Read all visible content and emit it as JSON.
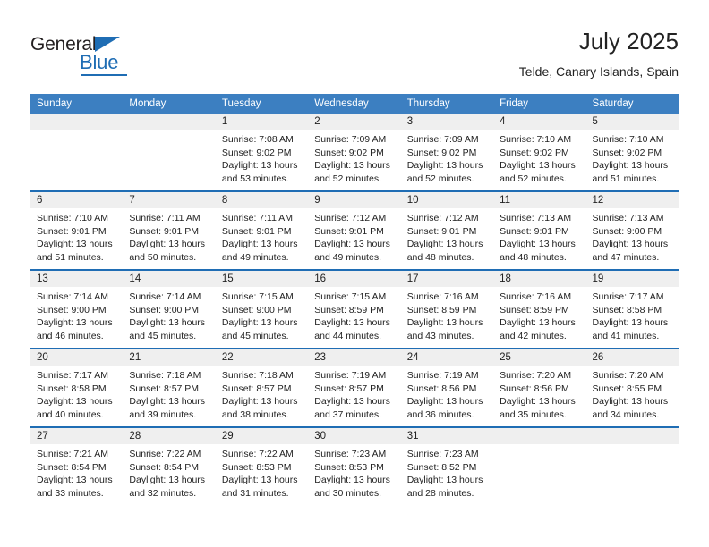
{
  "brand": {
    "name_top": "General",
    "name_bottom": "Blue"
  },
  "header": {
    "title": "July 2025",
    "location": "Telde, Canary Islands, Spain"
  },
  "colors": {
    "header_blue": "#3c7fc1",
    "accent_blue": "#1f6db4",
    "day_band_gray": "#efefef"
  },
  "weekdays": [
    "Sunday",
    "Monday",
    "Tuesday",
    "Wednesday",
    "Thursday",
    "Friday",
    "Saturday"
  ],
  "weeks": [
    [
      {
        "day": "",
        "sunrise": "",
        "sunset": "",
        "daylight": ""
      },
      {
        "day": "",
        "sunrise": "",
        "sunset": "",
        "daylight": ""
      },
      {
        "day": "1",
        "sunrise": "Sunrise: 7:08 AM",
        "sunset": "Sunset: 9:02 PM",
        "daylight": "Daylight: 13 hours and 53 minutes."
      },
      {
        "day": "2",
        "sunrise": "Sunrise: 7:09 AM",
        "sunset": "Sunset: 9:02 PM",
        "daylight": "Daylight: 13 hours and 52 minutes."
      },
      {
        "day": "3",
        "sunrise": "Sunrise: 7:09 AM",
        "sunset": "Sunset: 9:02 PM",
        "daylight": "Daylight: 13 hours and 52 minutes."
      },
      {
        "day": "4",
        "sunrise": "Sunrise: 7:10 AM",
        "sunset": "Sunset: 9:02 PM",
        "daylight": "Daylight: 13 hours and 52 minutes."
      },
      {
        "day": "5",
        "sunrise": "Sunrise: 7:10 AM",
        "sunset": "Sunset: 9:02 PM",
        "daylight": "Daylight: 13 hours and 51 minutes."
      }
    ],
    [
      {
        "day": "6",
        "sunrise": "Sunrise: 7:10 AM",
        "sunset": "Sunset: 9:01 PM",
        "daylight": "Daylight: 13 hours and 51 minutes."
      },
      {
        "day": "7",
        "sunrise": "Sunrise: 7:11 AM",
        "sunset": "Sunset: 9:01 PM",
        "daylight": "Daylight: 13 hours and 50 minutes."
      },
      {
        "day": "8",
        "sunrise": "Sunrise: 7:11 AM",
        "sunset": "Sunset: 9:01 PM",
        "daylight": "Daylight: 13 hours and 49 minutes."
      },
      {
        "day": "9",
        "sunrise": "Sunrise: 7:12 AM",
        "sunset": "Sunset: 9:01 PM",
        "daylight": "Daylight: 13 hours and 49 minutes."
      },
      {
        "day": "10",
        "sunrise": "Sunrise: 7:12 AM",
        "sunset": "Sunset: 9:01 PM",
        "daylight": "Daylight: 13 hours and 48 minutes."
      },
      {
        "day": "11",
        "sunrise": "Sunrise: 7:13 AM",
        "sunset": "Sunset: 9:01 PM",
        "daylight": "Daylight: 13 hours and 48 minutes."
      },
      {
        "day": "12",
        "sunrise": "Sunrise: 7:13 AM",
        "sunset": "Sunset: 9:00 PM",
        "daylight": "Daylight: 13 hours and 47 minutes."
      }
    ],
    [
      {
        "day": "13",
        "sunrise": "Sunrise: 7:14 AM",
        "sunset": "Sunset: 9:00 PM",
        "daylight": "Daylight: 13 hours and 46 minutes."
      },
      {
        "day": "14",
        "sunrise": "Sunrise: 7:14 AM",
        "sunset": "Sunset: 9:00 PM",
        "daylight": "Daylight: 13 hours and 45 minutes."
      },
      {
        "day": "15",
        "sunrise": "Sunrise: 7:15 AM",
        "sunset": "Sunset: 9:00 PM",
        "daylight": "Daylight: 13 hours and 45 minutes."
      },
      {
        "day": "16",
        "sunrise": "Sunrise: 7:15 AM",
        "sunset": "Sunset: 8:59 PM",
        "daylight": "Daylight: 13 hours and 44 minutes."
      },
      {
        "day": "17",
        "sunrise": "Sunrise: 7:16 AM",
        "sunset": "Sunset: 8:59 PM",
        "daylight": "Daylight: 13 hours and 43 minutes."
      },
      {
        "day": "18",
        "sunrise": "Sunrise: 7:16 AM",
        "sunset": "Sunset: 8:59 PM",
        "daylight": "Daylight: 13 hours and 42 minutes."
      },
      {
        "day": "19",
        "sunrise": "Sunrise: 7:17 AM",
        "sunset": "Sunset: 8:58 PM",
        "daylight": "Daylight: 13 hours and 41 minutes."
      }
    ],
    [
      {
        "day": "20",
        "sunrise": "Sunrise: 7:17 AM",
        "sunset": "Sunset: 8:58 PM",
        "daylight": "Daylight: 13 hours and 40 minutes."
      },
      {
        "day": "21",
        "sunrise": "Sunrise: 7:18 AM",
        "sunset": "Sunset: 8:57 PM",
        "daylight": "Daylight: 13 hours and 39 minutes."
      },
      {
        "day": "22",
        "sunrise": "Sunrise: 7:18 AM",
        "sunset": "Sunset: 8:57 PM",
        "daylight": "Daylight: 13 hours and 38 minutes."
      },
      {
        "day": "23",
        "sunrise": "Sunrise: 7:19 AM",
        "sunset": "Sunset: 8:57 PM",
        "daylight": "Daylight: 13 hours and 37 minutes."
      },
      {
        "day": "24",
        "sunrise": "Sunrise: 7:19 AM",
        "sunset": "Sunset: 8:56 PM",
        "daylight": "Daylight: 13 hours and 36 minutes."
      },
      {
        "day": "25",
        "sunrise": "Sunrise: 7:20 AM",
        "sunset": "Sunset: 8:56 PM",
        "daylight": "Daylight: 13 hours and 35 minutes."
      },
      {
        "day": "26",
        "sunrise": "Sunrise: 7:20 AM",
        "sunset": "Sunset: 8:55 PM",
        "daylight": "Daylight: 13 hours and 34 minutes."
      }
    ],
    [
      {
        "day": "27",
        "sunrise": "Sunrise: 7:21 AM",
        "sunset": "Sunset: 8:54 PM",
        "daylight": "Daylight: 13 hours and 33 minutes."
      },
      {
        "day": "28",
        "sunrise": "Sunrise: 7:22 AM",
        "sunset": "Sunset: 8:54 PM",
        "daylight": "Daylight: 13 hours and 32 minutes."
      },
      {
        "day": "29",
        "sunrise": "Sunrise: 7:22 AM",
        "sunset": "Sunset: 8:53 PM",
        "daylight": "Daylight: 13 hours and 31 minutes."
      },
      {
        "day": "30",
        "sunrise": "Sunrise: 7:23 AM",
        "sunset": "Sunset: 8:53 PM",
        "daylight": "Daylight: 13 hours and 30 minutes."
      },
      {
        "day": "31",
        "sunrise": "Sunrise: 7:23 AM",
        "sunset": "Sunset: 8:52 PM",
        "daylight": "Daylight: 13 hours and 28 minutes."
      },
      {
        "day": "",
        "sunrise": "",
        "sunset": "",
        "daylight": ""
      },
      {
        "day": "",
        "sunrise": "",
        "sunset": "",
        "daylight": ""
      }
    ]
  ]
}
